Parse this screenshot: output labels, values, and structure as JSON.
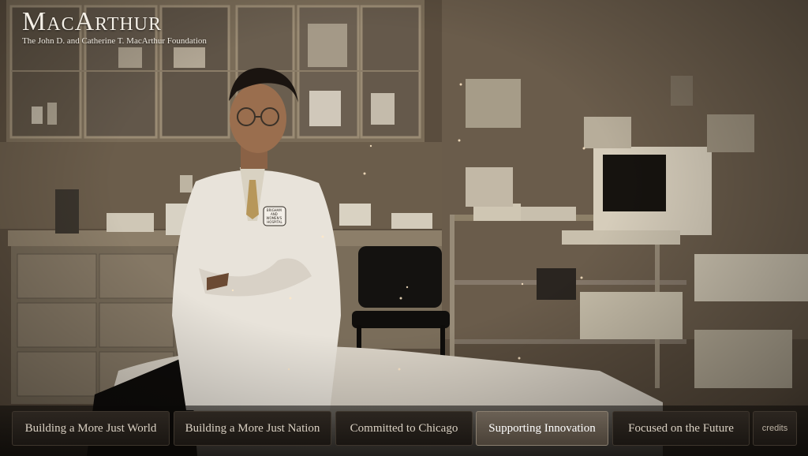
{
  "branding": {
    "title": "MacArthur",
    "subtitle": "The John D. and Catherine T. MacArthur Foundation"
  },
  "scene": {
    "coat_badge_lines": [
      "BRIGHAM",
      "AND",
      "WOMEN'S",
      "HOSPITAL"
    ]
  },
  "nav": {
    "items": [
      {
        "label": "Building a More Just World",
        "active": false
      },
      {
        "label": "Building a More Just Nation",
        "active": false
      },
      {
        "label": "Committed to Chicago",
        "active": false
      },
      {
        "label": "Supporting Innovation",
        "active": true
      },
      {
        "label": "Focused on the Future",
        "active": false
      }
    ],
    "credits_label": "credits"
  },
  "colors": {
    "text_light": "#f4efe6",
    "nav_active_bg": "#5a5046",
    "nav_bg": "#231e19"
  }
}
